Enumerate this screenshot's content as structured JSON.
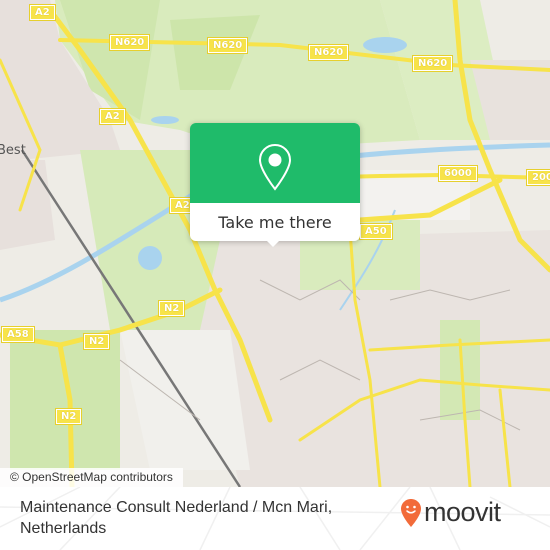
{
  "map": {
    "shields": [
      {
        "id": "a2-top",
        "label": "A2"
      },
      {
        "id": "n620-1",
        "label": "N620"
      },
      {
        "id": "n620-2",
        "label": "N620"
      },
      {
        "id": "n620-3",
        "label": "N620"
      },
      {
        "id": "n620-4",
        "label": "N620"
      },
      {
        "id": "a2-mid",
        "label": "A2"
      },
      {
        "id": "a2-low",
        "label": "A2"
      },
      {
        "id": "r6000",
        "label": "6000"
      },
      {
        "id": "r2000",
        "label": "200"
      },
      {
        "id": "a50",
        "label": "A50"
      },
      {
        "id": "n2-1",
        "label": "N2"
      },
      {
        "id": "n2-2",
        "label": "N2"
      },
      {
        "id": "n2-3",
        "label": "N2"
      },
      {
        "id": "a58",
        "label": "A58"
      }
    ],
    "place_labels": {
      "best": "Best"
    },
    "colors": {
      "land": "#eeece6",
      "green": "#d7ebb8",
      "forest": "#c5e0a0",
      "water": "#a9d3ee",
      "road": "#f7e34a",
      "urban": "#e9e3df"
    }
  },
  "popup": {
    "button_label": "Take me there",
    "icon": "map-pin-icon",
    "accent_color": "#1fbb6a"
  },
  "attribution": "© OpenStreetMap contributors",
  "footer": {
    "place_name": "Maintenance Consult Nederland / Mcn Mari, Netherlands",
    "brand": "moovit",
    "brand_color": "#f26b3a"
  }
}
